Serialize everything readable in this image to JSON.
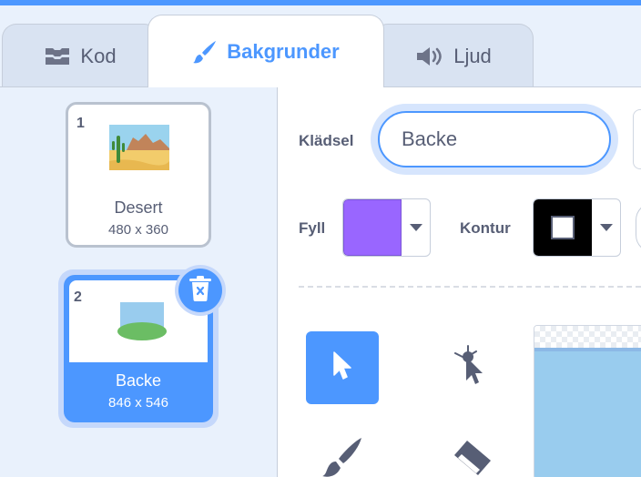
{
  "tabs": [
    {
      "label": "Kod",
      "icon": "code-icon"
    },
    {
      "label": "Bakgrunder",
      "icon": "brush-icon",
      "active": true
    },
    {
      "label": "Ljud",
      "icon": "speaker-icon"
    }
  ],
  "costumes": [
    {
      "number": "1",
      "name": "Desert",
      "size": "480 x 360"
    },
    {
      "number": "2",
      "name": "Backe",
      "size": "846 x 546",
      "selected": true
    }
  ],
  "editor": {
    "costume_label": "Klädsel",
    "costume_name": "Backe",
    "fill_label": "Fyll",
    "fill_color": "#9966ff",
    "outline_label": "Kontur",
    "outline_color": "#000000"
  },
  "tools": [
    "select-tool",
    "reshape-tool",
    "brush-tool",
    "eraser-tool"
  ],
  "colors": {
    "accent": "#4c97ff",
    "text": "#575e75",
    "sidebar_bg": "#e9f1fc"
  }
}
